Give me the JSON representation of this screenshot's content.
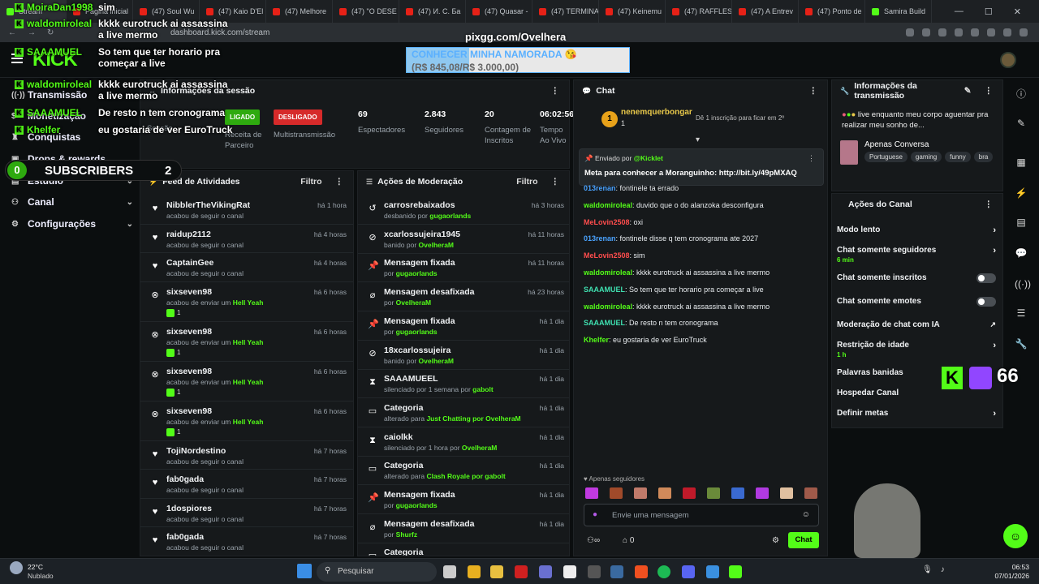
{
  "browser": {
    "tabs": [
      "Stream",
      "Página inicial",
      "(47) Soul Wu",
      "(47) Kaio D'El",
      "(47) Melhore",
      "(47) \"O DESE",
      "(47) И. С. Ба",
      "(47) Quasar -",
      "(47) TERMINA",
      "(47) Keinemu",
      "(47) RAFFLES",
      "(47) A Entrev",
      "(47) Ponto de",
      "Samira Build"
    ],
    "url": "dashboard.kick.com/stream"
  },
  "overlay": {
    "watermark": "pixgg.com/Ovelhera",
    "goal_title": "CONHECER MINHA NAMORADA 😘",
    "goal_current": "R$ 845,08",
    "goal_target": "/R$ 3.000,00)",
    "goal_open": "(",
    "subs_label": "SUBSCRIBERS",
    "subs_left": "0",
    "subs_right": "2",
    "viewer_count": "66",
    "progress_fraction": 0.28,
    "chat": [
      {
        "user": "MoiraDan1998",
        "text": "sim"
      },
      {
        "user": "waldomiroleal",
        "text": "kkkk eurotruck ai assassina a live mermo"
      },
      {
        "user": "SAAAMUEL",
        "text": "So tem que ter horario pra começar a live"
      },
      {
        "user": "waldomiroleal",
        "text": "kkkk eurotruck ai assassina a live mermo"
      },
      {
        "user": "SAAAMUEL",
        "text": "De resto n tem cronograma"
      },
      {
        "user": "Khelfer",
        "text": "eu gostaria de ver EuroTruck"
      }
    ]
  },
  "sidebar": {
    "items": [
      {
        "label": "Transmissão",
        "icon": "broadcast-icon"
      },
      {
        "label": "Monetização",
        "icon": "money-icon"
      },
      {
        "label": "Conquistas",
        "icon": "trophy-icon"
      },
      {
        "label": "Drops & rewards",
        "icon": "gift-icon"
      },
      {
        "label": "Estúdio",
        "icon": "studio-icon"
      },
      {
        "label": "Canal",
        "icon": "channel-icon"
      },
      {
        "label": "Configurações",
        "icon": "gear-icon"
      }
    ]
  },
  "session": {
    "title": "Informações da sessão",
    "badges": {
      "live": "LIGADO",
      "off": "DESLIGADO"
    },
    "labels": {
      "session": "Sessão",
      "revenue": "Receita de Parceiro",
      "multi": "Multistransmissão",
      "viewers": "Espectadores",
      "followers": "Seguidores",
      "subs": "Contagem de Inscritos",
      "live": "Tempo Ao Vivo"
    },
    "values": {
      "viewers": "69",
      "followers": "2.843",
      "subs": "20",
      "time": "06:02:56"
    }
  },
  "activity": {
    "title": "Feed de Atividades",
    "filter": "Filtro",
    "items": [
      {
        "name": "NibblerTheVikingRat",
        "sub": "acabou de seguir o canal",
        "time": "há 1 hora",
        "icon": "heart",
        "gift": ""
      },
      {
        "name": "raidup2112",
        "sub": "acabou de seguir o canal",
        "time": "há 4 horas",
        "icon": "heart",
        "gift": ""
      },
      {
        "name": "CaptainGee",
        "sub": "acabou de seguir o canal",
        "time": "há 4 horas",
        "icon": "heart",
        "gift": ""
      },
      {
        "name": "sixseven98",
        "sub": "acabou de enviar um ",
        "em": "Hell Yeah",
        "time": "há 6 horas",
        "icon": "x",
        "gift": "1"
      },
      {
        "name": "sixseven98",
        "sub": "acabou de enviar um ",
        "em": "Hell Yeah",
        "time": "há 6 horas",
        "icon": "x",
        "gift": "1"
      },
      {
        "name": "sixseven98",
        "sub": "acabou de enviar um ",
        "em": "Hell Yeah",
        "time": "há 6 horas",
        "icon": "x",
        "gift": "1"
      },
      {
        "name": "sixseven98",
        "sub": "acabou de enviar um ",
        "em": "Hell Yeah",
        "time": "há 6 horas",
        "icon": "x",
        "gift": "1"
      },
      {
        "name": "TojiNordestino",
        "sub": "acabou de seguir o canal",
        "time": "há 7 horas",
        "icon": "heart",
        "gift": ""
      },
      {
        "name": "fab0gada",
        "sub": "acabou de seguir o canal",
        "time": "há 7 horas",
        "icon": "heart",
        "gift": ""
      },
      {
        "name": "1dospiores",
        "sub": "acabou de seguir o canal",
        "time": "há 7 horas",
        "icon": "heart",
        "gift": ""
      },
      {
        "name": "fab0gada",
        "sub": "acabou de seguir o canal",
        "time": "há 7 horas",
        "icon": "heart",
        "gift": ""
      }
    ]
  },
  "moderation": {
    "title": "Ações de Moderação",
    "filter": "Filtro",
    "items": [
      {
        "name": "carrosrebaixados",
        "sub": "desbanido por ",
        "em": "gugaorlands",
        "time": "há 3 horas",
        "icon": "↺"
      },
      {
        "name": "xcarlossujeira1945",
        "sub": "banido por ",
        "em": "OvelheraM",
        "time": "há 11 horas",
        "icon": "⊘"
      },
      {
        "name": "Mensagem fixada",
        "sub": "por ",
        "em": "gugaorlands",
        "time": "há 11 horas",
        "icon": "📌"
      },
      {
        "name": "Mensagem desafixada",
        "sub": "por ",
        "em": "OvelheraM",
        "time": "há 23 horas",
        "icon": "⌀"
      },
      {
        "name": "Mensagem fixada",
        "sub": "por ",
        "em": "gugaorlands",
        "time": "há 1 dia",
        "icon": "📌"
      },
      {
        "name": "18xcarlossujeira",
        "sub": "banido por ",
        "em": "OvelheraM",
        "time": "há 1 dia",
        "icon": "⊘"
      },
      {
        "name": "SAAAMUEEL",
        "sub": "silenciado por 1 semana por ",
        "em": "gabolt",
        "time": "há 1 dia",
        "icon": "⧗"
      },
      {
        "name": "Categoria",
        "sub": "alterado para ",
        "em": "Just Chatting por OvelheraM",
        "time": "há 1 dia",
        "icon": "▭"
      },
      {
        "name": "caiolkk",
        "sub": "silenciado por 1 hora por ",
        "em": "OvelheraM",
        "time": "há 1 dia",
        "icon": "⧗"
      },
      {
        "name": "Categoria",
        "sub": "alterado para ",
        "em": "Clash Royale por gabolt",
        "time": "há 1 dia",
        "icon": "▭"
      },
      {
        "name": "Mensagem fixada",
        "sub": "por ",
        "em": "gugaorlands",
        "time": "há 1 dia",
        "icon": "📌"
      },
      {
        "name": "Mensagem desafixada",
        "sub": "por ",
        "em": "Shurfz",
        "time": "há 1 dia",
        "icon": "⌀"
      },
      {
        "name": "Categoria",
        "sub": "",
        "em": "",
        "time": "",
        "icon": "▭"
      }
    ]
  },
  "chat": {
    "title": "Chat",
    "top_gifter": "nenemquerbongar",
    "top_gifter_count": "1",
    "gift_note": "Dê 1 inscrição para ficar em 2º",
    "pinned_by_label": "Enviado por",
    "pinned_by": "@Kicklet",
    "pinned_text": "Meta para conhecer a Moranguinho: http://bit.ly/49pMXAQ",
    "messages": [
      {
        "user": "013renan",
        "text": "fontinele ta errado",
        "color": "#4aa3ff"
      },
      {
        "user": "waldomiroleal",
        "text": "duvido que o do alanzoka desconfigura",
        "color": "#53fc18"
      },
      {
        "user": "MeLovin2508",
        "text": "oxi",
        "color": "#ff4d4d"
      },
      {
        "user": "013renan",
        "text": "fontinele disse q tem cronograma ate 2027",
        "color": "#4aa3ff"
      },
      {
        "user": "MeLovin2508",
        "text": "sim",
        "color": "#ff4d4d"
      },
      {
        "user": "waldomiroleal",
        "text": "kkkk eurotruck ai assassina a live mermo",
        "color": "#53fc18"
      },
      {
        "user": "SAAAMUEL",
        "text": "So tem que ter horario pra começar a live",
        "color": "#3fe0b0"
      },
      {
        "user": "waldomiroleal",
        "text": "kkkk eurotruck ai assassina a live mermo",
        "color": "#53fc18"
      },
      {
        "user": "SAAAMUEL",
        "text": "De resto n tem cronograma",
        "color": "#3fe0b0"
      },
      {
        "user": "Khelfer",
        "text": "eu gostaria de ver EuroTruck",
        "color": "#53fc18"
      }
    ],
    "followers_only": "Apenas seguidores",
    "placeholder": "Envie uma mensagem",
    "points": "0",
    "send": "Chat"
  },
  "transmission": {
    "title": "Informações da transmissão",
    "stream_title": "live enquanto meu corpo aguentar pra realizar meu sonho de...",
    "category": "Apenas Conversa",
    "tags": [
      "Portuguese",
      "gaming",
      "funny",
      "bra"
    ]
  },
  "channel_actions": {
    "title": "Ações do Canal",
    "items": [
      {
        "label": "Modo lento",
        "sub": "",
        "ctl": "chevron"
      },
      {
        "label": "Chat somente seguidores",
        "sub": "6 min",
        "ctl": "chevron"
      },
      {
        "label": "Chat somente inscritos",
        "sub": "",
        "ctl": "toggle"
      },
      {
        "label": "Chat somente emotes",
        "sub": "",
        "ctl": "toggle"
      },
      {
        "label": "Moderação de chat com IA",
        "sub": "",
        "ctl": "link"
      },
      {
        "label": "Restrição de idade",
        "sub": "1 h",
        "ctl": "chevron"
      },
      {
        "label": "Palavras banidas",
        "sub": "",
        "ctl": "none"
      },
      {
        "label": "Hospedar Canal",
        "sub": "",
        "ctl": "none"
      },
      {
        "label": "Definir metas",
        "sub": "",
        "ctl": "chevron"
      }
    ]
  },
  "taskbar": {
    "temp": "22°C",
    "weather": "Nublado",
    "search": "Pesquisar",
    "time": "06:53",
    "date": "07/01/2026"
  },
  "colors": {
    "accent": "#53fc18",
    "live": "#2eaa0f",
    "off": "#d62a2a",
    "panel": "#16191b"
  }
}
